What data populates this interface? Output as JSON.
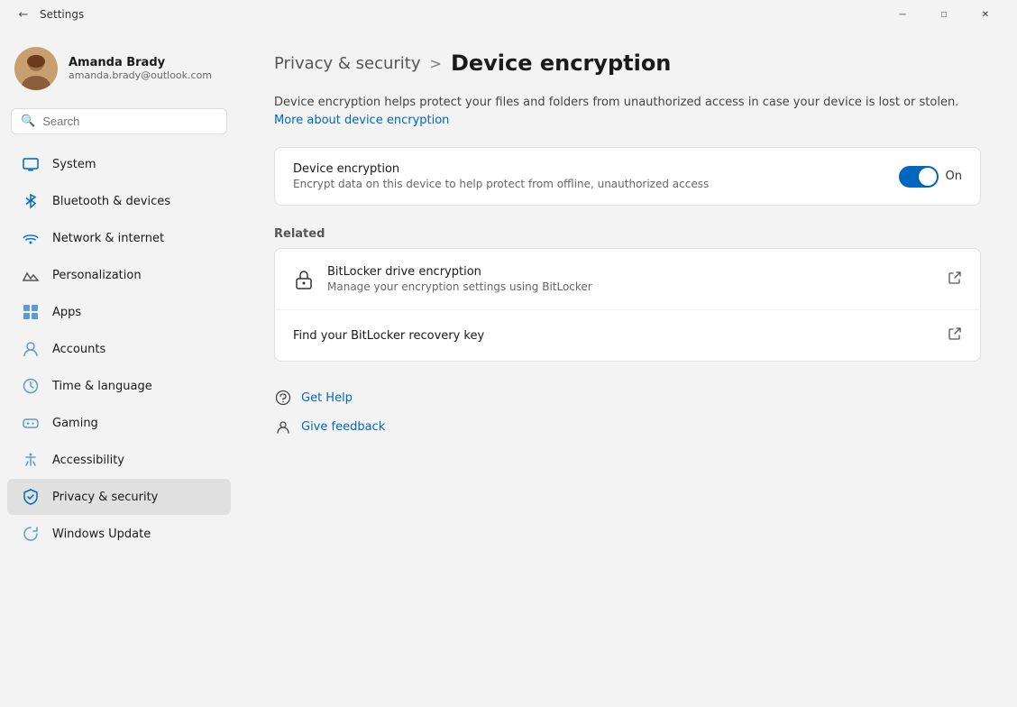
{
  "titlebar": {
    "title": "Settings",
    "min_label": "─",
    "max_label": "□",
    "close_label": "✕"
  },
  "sidebar": {
    "user": {
      "name": "Amanda Brady",
      "email": "amanda.brady@outlook.com"
    },
    "search": {
      "placeholder": "Search"
    },
    "nav_items": [
      {
        "id": "system",
        "label": "System",
        "icon": "system"
      },
      {
        "id": "bluetooth",
        "label": "Bluetooth & devices",
        "icon": "bluetooth"
      },
      {
        "id": "network",
        "label": "Network & internet",
        "icon": "network"
      },
      {
        "id": "personalization",
        "label": "Personalization",
        "icon": "personalization"
      },
      {
        "id": "apps",
        "label": "Apps",
        "icon": "apps"
      },
      {
        "id": "accounts",
        "label": "Accounts",
        "icon": "accounts"
      },
      {
        "id": "time",
        "label": "Time & language",
        "icon": "time"
      },
      {
        "id": "gaming",
        "label": "Gaming",
        "icon": "gaming"
      },
      {
        "id": "accessibility",
        "label": "Accessibility",
        "icon": "accessibility"
      },
      {
        "id": "privacy",
        "label": "Privacy & security",
        "icon": "privacy",
        "active": true
      },
      {
        "id": "update",
        "label": "Windows Update",
        "icon": "update"
      }
    ]
  },
  "main": {
    "breadcrumb_parent": "Privacy & security",
    "breadcrumb_sep": ">",
    "breadcrumb_current": "Device encryption",
    "description_text": "Device encryption helps protect your files and folders from unauthorized access in case your device is lost or stolen.",
    "description_link": "More about device encryption",
    "device_encryption": {
      "title": "Device encryption",
      "subtitle": "Encrypt data on this device to help protect from offline, unauthorized access",
      "toggle_state": "On",
      "toggle_on": true
    },
    "related_section_title": "Related",
    "related_items": [
      {
        "id": "bitlocker",
        "label": "BitLocker drive encryption",
        "subtitle": "Manage your encryption settings using BitLocker",
        "has_icon": true
      },
      {
        "id": "recovery",
        "label": "Find your BitLocker recovery key",
        "has_icon": false
      }
    ],
    "support_links": [
      {
        "id": "help",
        "label": "Get Help"
      },
      {
        "id": "feedback",
        "label": "Give feedback"
      }
    ]
  },
  "colors": {
    "accent": "#0067c0",
    "active_nav_bg": "#e0e0e0"
  }
}
